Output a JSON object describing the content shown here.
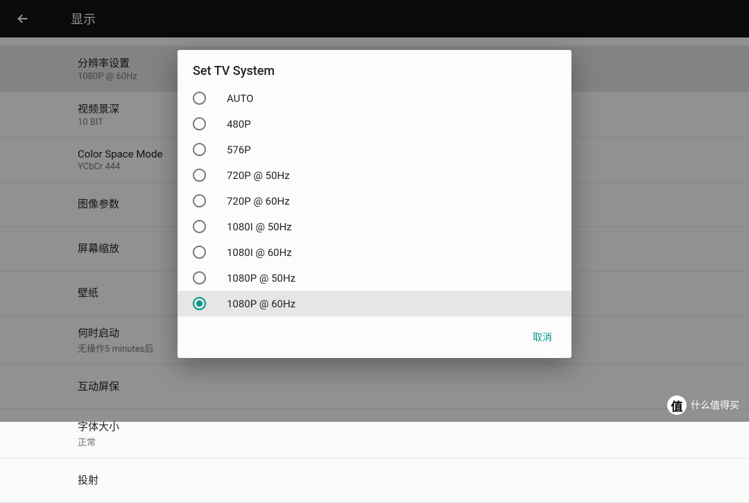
{
  "header": {
    "title": "显示"
  },
  "settings": [
    {
      "title": "分辨率设置",
      "subtitle": "1080P @ 60Hz",
      "highlighted": true
    },
    {
      "title": "视频景深",
      "subtitle": "10 BIT"
    },
    {
      "title": "Color Space Mode",
      "subtitle": "YCbCr 444"
    },
    {
      "title": "图像参数",
      "subtitle": null
    },
    {
      "title": "屏幕缩放",
      "subtitle": null
    },
    {
      "title": "壁纸",
      "subtitle": null
    },
    {
      "title": "何时启动",
      "subtitle": "无操作5 minutes后"
    },
    {
      "title": "互动屏保",
      "subtitle": null
    },
    {
      "title": "字体大小",
      "subtitle": "正常"
    },
    {
      "title": "投射",
      "subtitle": null
    }
  ],
  "dialog": {
    "title": "Set TV System",
    "options": [
      {
        "label": "AUTO",
        "selected": false
      },
      {
        "label": "480P",
        "selected": false
      },
      {
        "label": "576P",
        "selected": false
      },
      {
        "label": "720P @ 50Hz",
        "selected": false
      },
      {
        "label": "720P @ 60Hz",
        "selected": false
      },
      {
        "label": "1080I @ 50Hz",
        "selected": false
      },
      {
        "label": "1080I @ 60Hz",
        "selected": false
      },
      {
        "label": "1080P @ 50Hz",
        "selected": false
      },
      {
        "label": "1080P @ 60Hz",
        "selected": true
      }
    ],
    "cancel_label": "取消"
  },
  "watermark": {
    "badge": "值",
    "text": "什么值得买"
  }
}
